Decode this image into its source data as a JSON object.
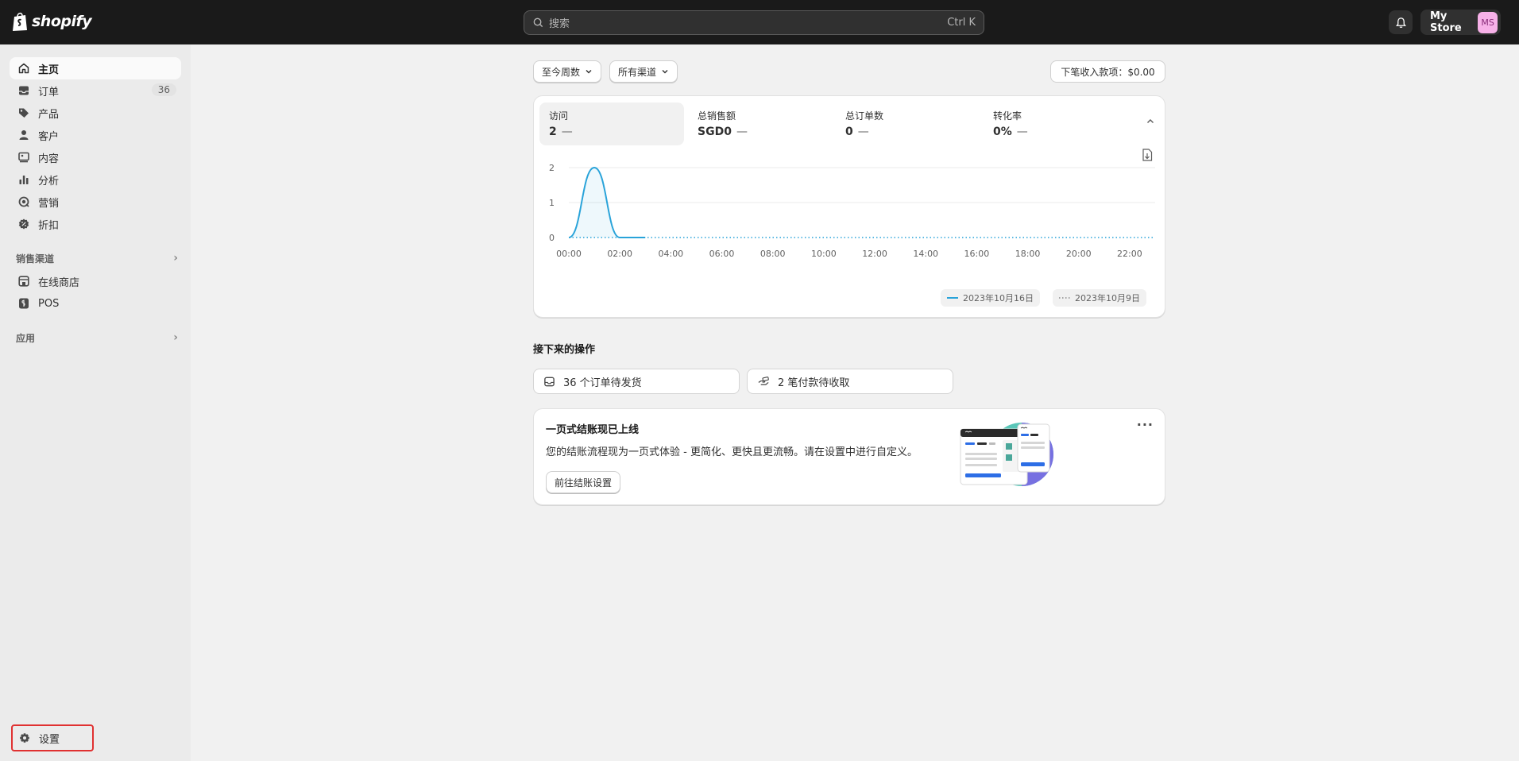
{
  "header": {
    "brand": "shopify",
    "search_placeholder": "搜索",
    "search_shortcut": "Ctrl K",
    "store_name": "My Store",
    "avatar_initials": "MS"
  },
  "sidebar": {
    "items": [
      {
        "label": "主页",
        "icon": "home-icon",
        "active": true
      },
      {
        "label": "订单",
        "icon": "inbox-icon",
        "badge": "36"
      },
      {
        "label": "产品",
        "icon": "tag-icon"
      },
      {
        "label": "客户",
        "icon": "person-icon"
      },
      {
        "label": "内容",
        "icon": "content-icon"
      },
      {
        "label": "分析",
        "icon": "chart-bar-icon"
      },
      {
        "label": "营销",
        "icon": "target-icon"
      },
      {
        "label": "折扣",
        "icon": "discount-icon"
      }
    ],
    "sales_channels_label": "销售渠道",
    "channels": [
      {
        "label": "在线商店",
        "icon": "store-icon"
      },
      {
        "label": "POS",
        "icon": "pos-icon"
      }
    ],
    "apps_label": "应用",
    "settings_label": "设置"
  },
  "filters": {
    "date_range": "至今周数",
    "channel": "所有渠道",
    "payout": "下笔收入款项：$0.00"
  },
  "metrics": [
    {
      "label": "访问",
      "value": "2",
      "change": "—"
    },
    {
      "label": "总销售额",
      "value": "SGD0",
      "change": "—"
    },
    {
      "label": "总订单数",
      "value": "0",
      "change": "—"
    },
    {
      "label": "转化率",
      "value": "0%",
      "change": "—"
    }
  ],
  "chart_data": {
    "type": "line",
    "title": "",
    "xlabel": "",
    "ylabel": "",
    "x": [
      "00:00",
      "01:00",
      "02:00",
      "03:00",
      "04:00",
      "05:00",
      "06:00",
      "07:00",
      "08:00",
      "09:00",
      "10:00",
      "11:00",
      "12:00",
      "13:00",
      "14:00",
      "15:00",
      "16:00",
      "17:00",
      "18:00",
      "19:00",
      "20:00",
      "21:00",
      "22:00",
      "23:00"
    ],
    "x_tick_labels": [
      "00:00",
      "02:00",
      "04:00",
      "06:00",
      "08:00",
      "10:00",
      "12:00",
      "14:00",
      "16:00",
      "18:00",
      "20:00",
      "22:00"
    ],
    "ylim": [
      0,
      2
    ],
    "y_ticks": [
      "0",
      "1",
      "2"
    ],
    "series": [
      {
        "name": "2023年10月16日",
        "style": "solid",
        "color": "#29a3d9",
        "values": [
          0,
          2,
          0,
          0
        ]
      },
      {
        "name": "2023年10月9日",
        "style": "dotted",
        "color": "#29a3d9",
        "values": [
          0,
          0,
          0,
          0,
          0,
          0,
          0,
          0,
          0,
          0,
          0,
          0,
          0,
          0,
          0,
          0,
          0,
          0,
          0,
          0,
          0,
          0,
          0,
          0
        ]
      }
    ],
    "grid": true,
    "legend_position": "bottom-right"
  },
  "next_steps": {
    "title": "接下来的操作",
    "tasks": [
      {
        "label": "36 个订单待发货",
        "icon": "inbox-icon"
      },
      {
        "label": "2 笔付款待收取",
        "icon": "hand-money-icon"
      }
    ]
  },
  "promo": {
    "title": "一页式结账现已上线",
    "description": "您的结账流程现为一页式体验 - 更简化、更快且更流畅。请在设置中进行自定义。",
    "button": "前往结账设置",
    "more": "···"
  }
}
